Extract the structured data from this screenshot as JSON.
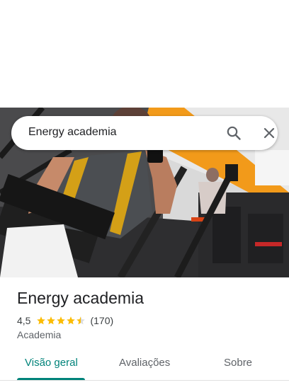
{
  "search": {
    "query": "Energy academia"
  },
  "place": {
    "name": "Energy academia",
    "rating": "4,5",
    "rating_value": 4.5,
    "reviews": "(170)",
    "category": "Academia"
  },
  "tabs": [
    {
      "label": "Visão geral",
      "active": true
    },
    {
      "label": "Avaliações",
      "active": false
    },
    {
      "label": "Sobre",
      "active": false
    }
  ],
  "colors": {
    "accent": "#01837a",
    "star": "#fbbc04",
    "gym_orange": "#f29a1a"
  },
  "icons": {
    "search": "search-icon",
    "close": "close-icon",
    "star": "star-icon"
  }
}
